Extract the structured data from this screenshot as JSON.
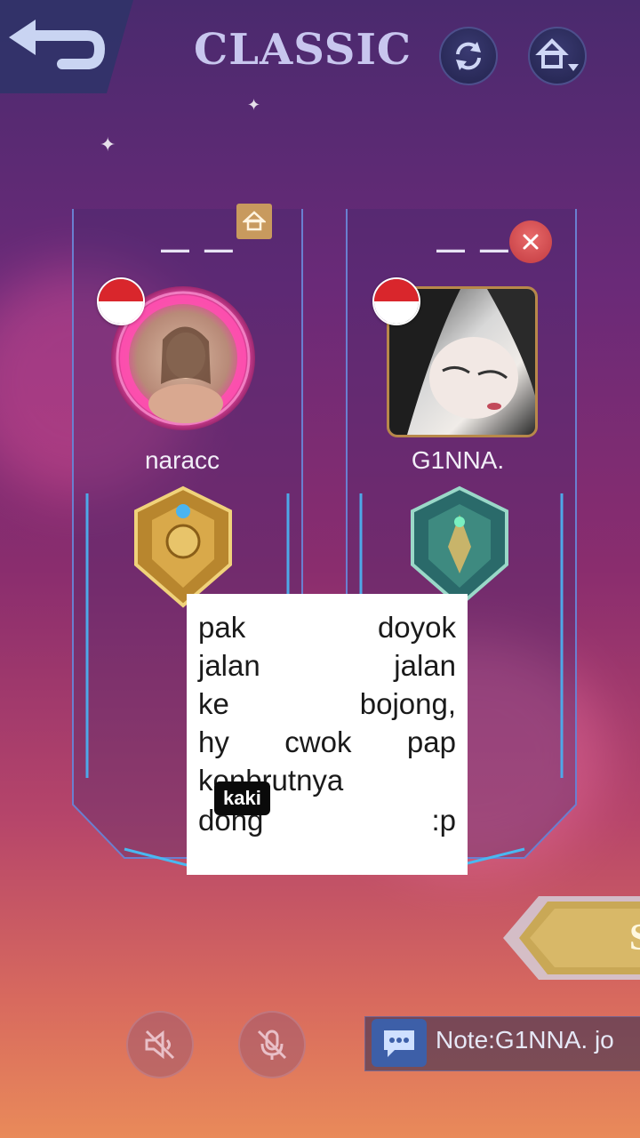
{
  "header": {
    "title": "CLASSIC",
    "back_icon": "back-arrow-icon",
    "refresh_icon": "refresh-icon",
    "home_icon": "home-dropdown-icon"
  },
  "slots": [
    {
      "rank_text": "— —",
      "player_name": "naracc",
      "flag": "indonesia-flag",
      "owner_icon": "home-icon"
    },
    {
      "rank_text": "— —",
      "player_name": "G1NNA.",
      "flag": "indonesia-flag",
      "remove_icon": "close-icon"
    }
  ],
  "caption": {
    "lines": [
      [
        "pak",
        "doyok"
      ],
      [
        "jalan",
        "jalan"
      ],
      [
        "ke",
        "bojong,"
      ],
      [
        "hy",
        "cwok",
        "pap"
      ],
      [
        "konbrutnya"
      ],
      [
        "dong",
        ":p"
      ]
    ],
    "tag": "kaki"
  },
  "bottom": {
    "speaker_icon": "speaker-muted-icon",
    "mic_icon": "mic-muted-icon",
    "chat_icon": "chat-icon",
    "note": "Note:G1NNA. jo",
    "start_partial": "S"
  },
  "colors": {
    "accent": "#c8c6ee",
    "gold": "#c89a5e",
    "flag_red": "#d9262c"
  }
}
